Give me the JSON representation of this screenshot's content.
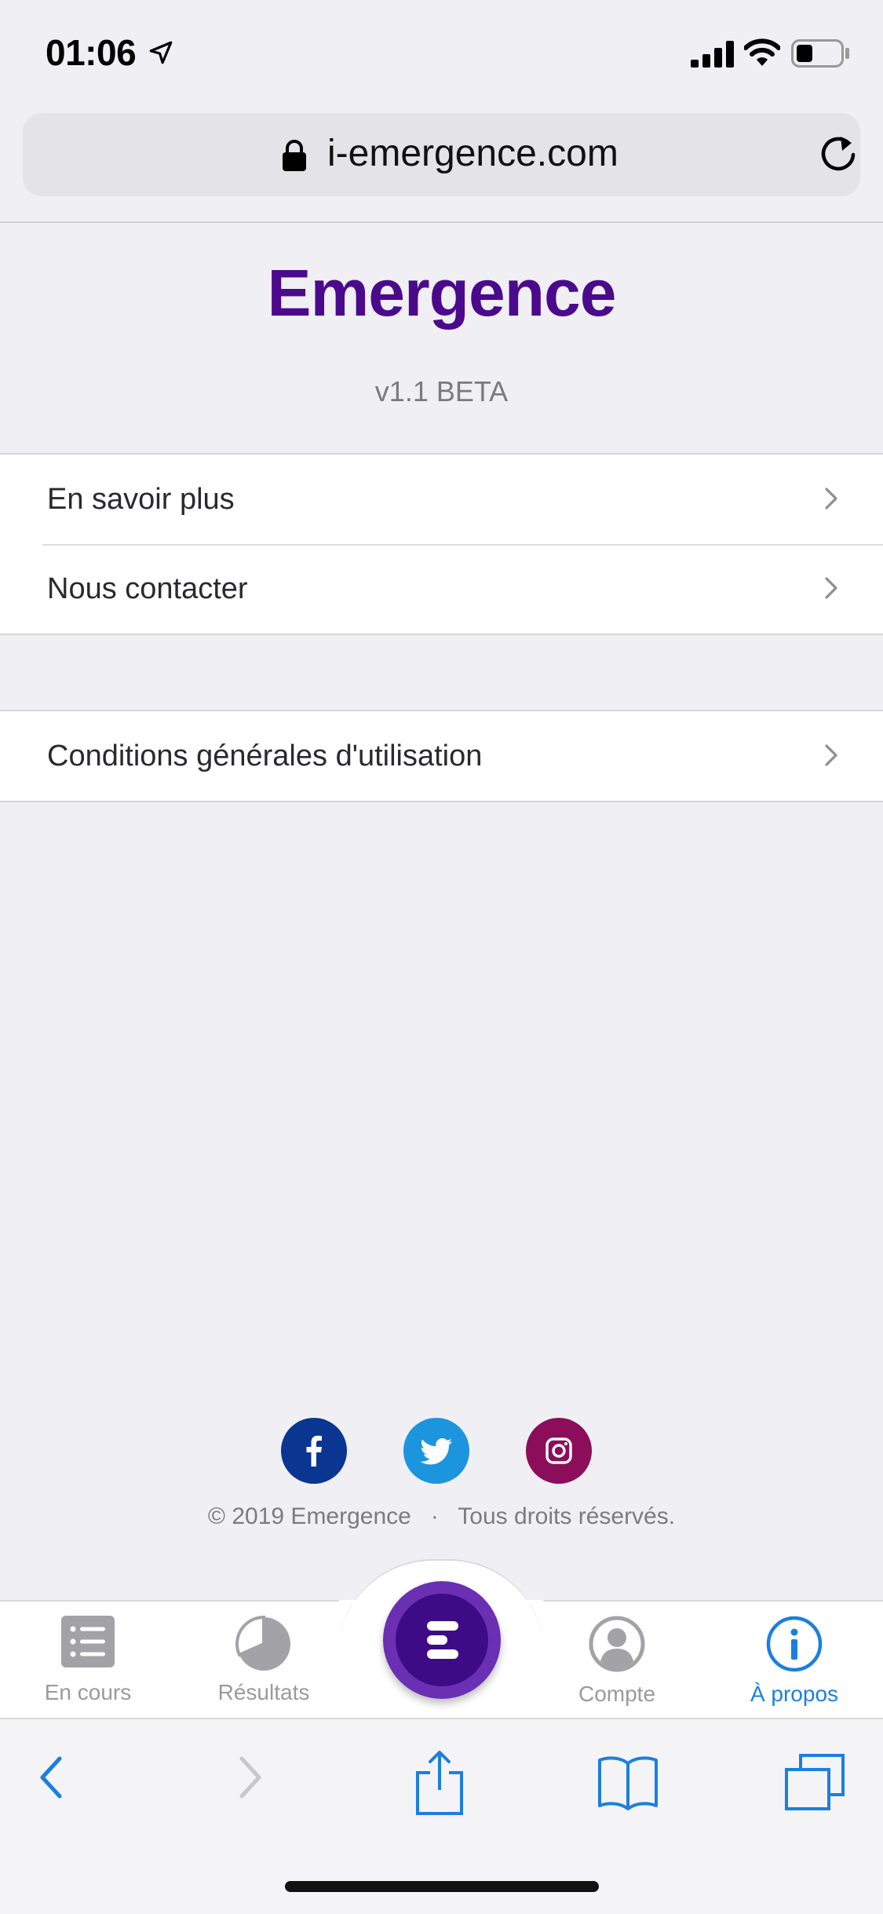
{
  "status_bar": {
    "time": "01:06",
    "icons": [
      "location-arrow-icon",
      "signal-icon",
      "wifi-icon",
      "battery-icon"
    ]
  },
  "browser": {
    "url": "i-emergence.com",
    "icons": [
      "lock-icon",
      "reload-icon"
    ],
    "toolbar": [
      "back-icon",
      "forward-icon",
      "share-icon",
      "bookmarks-icon",
      "tabs-icon"
    ]
  },
  "app": {
    "title": "Emergence",
    "version": "v1.1 BETA",
    "title_color": "#4b0a8c"
  },
  "menu": {
    "group1": [
      {
        "label": "En savoir plus"
      },
      {
        "label": "Nous contacter"
      }
    ],
    "group2": [
      {
        "label": "Conditions générales d'utilisation"
      }
    ]
  },
  "social": {
    "items": [
      {
        "name": "facebook",
        "color": "#0a3590"
      },
      {
        "name": "twitter",
        "color": "#1d94de"
      },
      {
        "name": "instagram",
        "color": "#8c0e5a"
      }
    ]
  },
  "footer": {
    "copyright": "© 2019 Emergence   ·   Tous droits réservés."
  },
  "tabbar": {
    "tabs": [
      {
        "label": "En cours",
        "icon": "list-icon"
      },
      {
        "label": "Résultats",
        "icon": "pie-chart-icon"
      },
      {
        "label": "Compte",
        "icon": "user-icon"
      },
      {
        "label": "À propos",
        "icon": "info-icon",
        "active": true
      }
    ],
    "active_color": "#1b7fe0",
    "center_icon": "emergence-logo-icon"
  }
}
